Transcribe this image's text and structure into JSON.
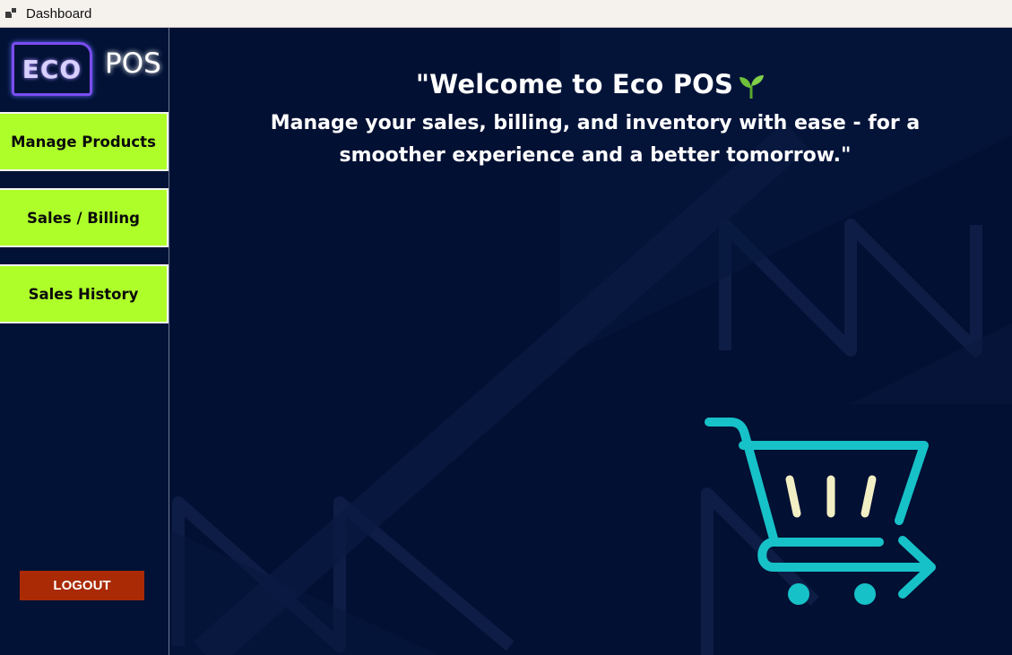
{
  "window": {
    "title": "Dashboard",
    "icon": "app-window-icon"
  },
  "sidebar": {
    "logo": {
      "badge": "ECO",
      "text": "POS"
    },
    "items": [
      {
        "label": "Manage Products"
      },
      {
        "label": "Sales / Billing"
      },
      {
        "label": "Sales History"
      }
    ],
    "logout_label": "LOGOUT"
  },
  "main": {
    "headline": "\"Welcome to Eco POS",
    "headline_icon": "sprout-icon",
    "tagline": "Manage your sales, billing, and inventory with ease - for a smoother experience and a better tomorrow.\"",
    "illustration": "shopping-cart-icon"
  },
  "colors": {
    "sidebar_bg": "#021236",
    "main_bg": "#021033",
    "nav_button": "#aeff2a",
    "logout_button": "#a92a04",
    "logo_border": "#7b4cf0",
    "cart_teal": "#17c1c8",
    "cart_bars": "#f3efc4",
    "sprout_green": "#6fc03a"
  }
}
